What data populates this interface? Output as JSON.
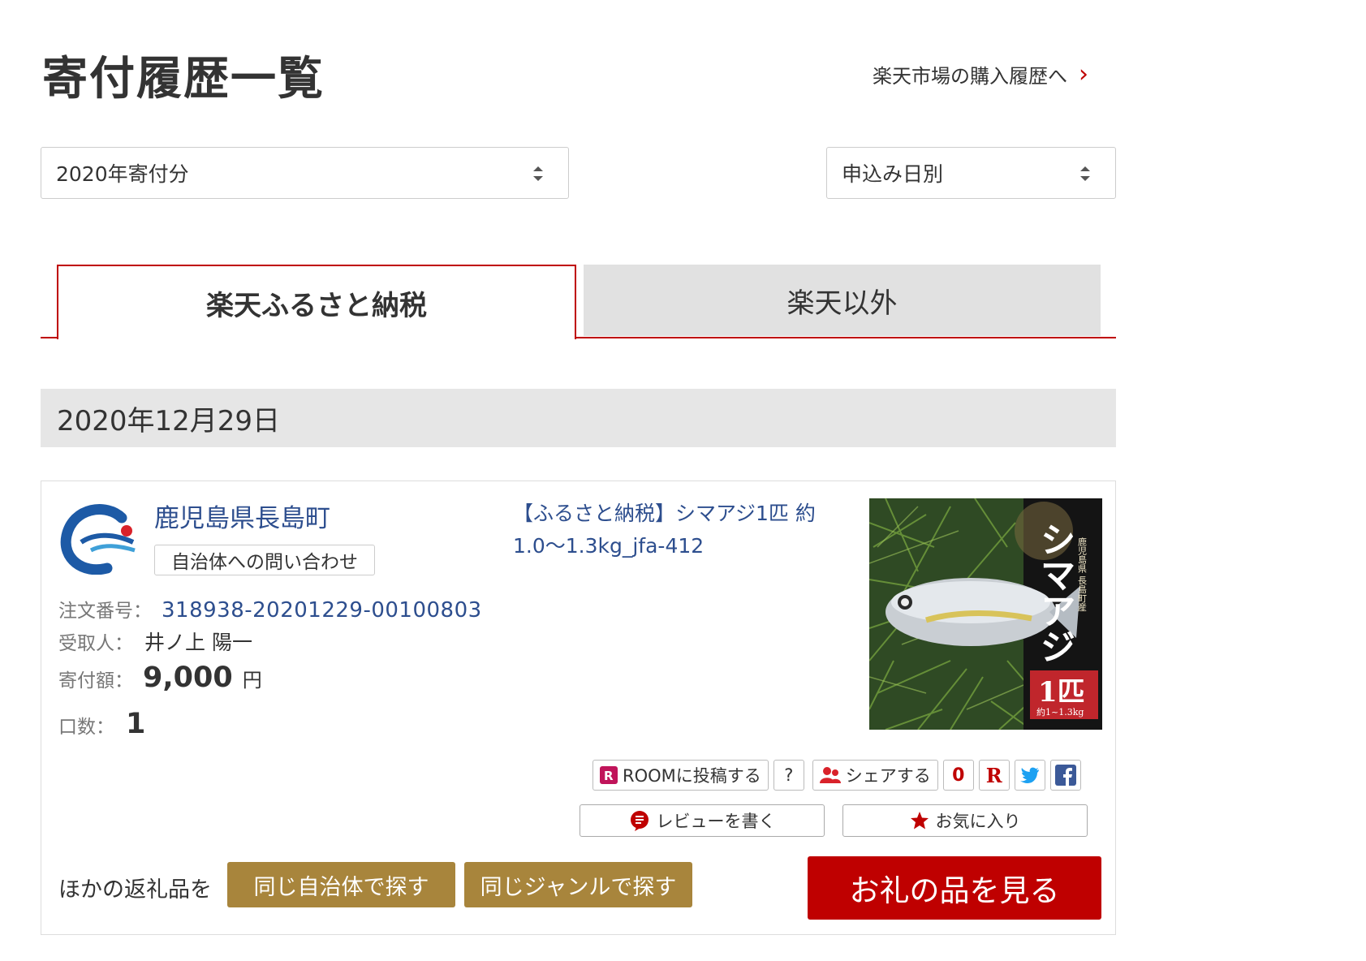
{
  "header": {
    "title": "寄付履歴一覧",
    "market_link": "楽天市場の購入履歴へ"
  },
  "filters": {
    "year": "2020年寄付分",
    "sort": "申込み日別"
  },
  "tabs": [
    {
      "label": "楽天ふるさと納税",
      "active": true
    },
    {
      "label": "楽天以外",
      "active": false
    }
  ],
  "date_group": "2020年12月29日",
  "donation": {
    "municipality": "鹿児島県長島町",
    "contact_button": "自治体への問い合わせ",
    "order_label": "注文番号：",
    "order_number": "318938-20201229-00100803",
    "recipient_label": "受取人：",
    "recipient": "井ノ上 陽一",
    "amount_label": "寄付額：",
    "amount": "9,000",
    "amount_unit": "円",
    "quantity_label": "口数：",
    "quantity": "1",
    "product_title": "【ふるさと納税】シマアジ1匹 約1.0～1.3kg_jfa-412",
    "image_text": {
      "title": "シマアジ",
      "origin": "鹿児島県 長島町産",
      "count": "1匹",
      "weight": "約1~1.3kg"
    }
  },
  "social": {
    "room_button": "ROOMに投稿する",
    "help": "?",
    "share_button": "シェアする",
    "share_count": "0",
    "rakuten_icon_label": "R"
  },
  "actions": {
    "review_button": "レビューを書く",
    "favorite_button": "お気に入り"
  },
  "footer": {
    "other_label": "ほかの返礼品を",
    "same_municipality": "同じ自治体で探す",
    "same_genre": "同じジャンルで探す",
    "view_gift": "お礼の品を見る"
  },
  "colors": {
    "accent_red": "#bf0000",
    "link_blue": "#2d4e8e",
    "gold": "#a8853c",
    "tab_gray": "#e1e1e1"
  }
}
